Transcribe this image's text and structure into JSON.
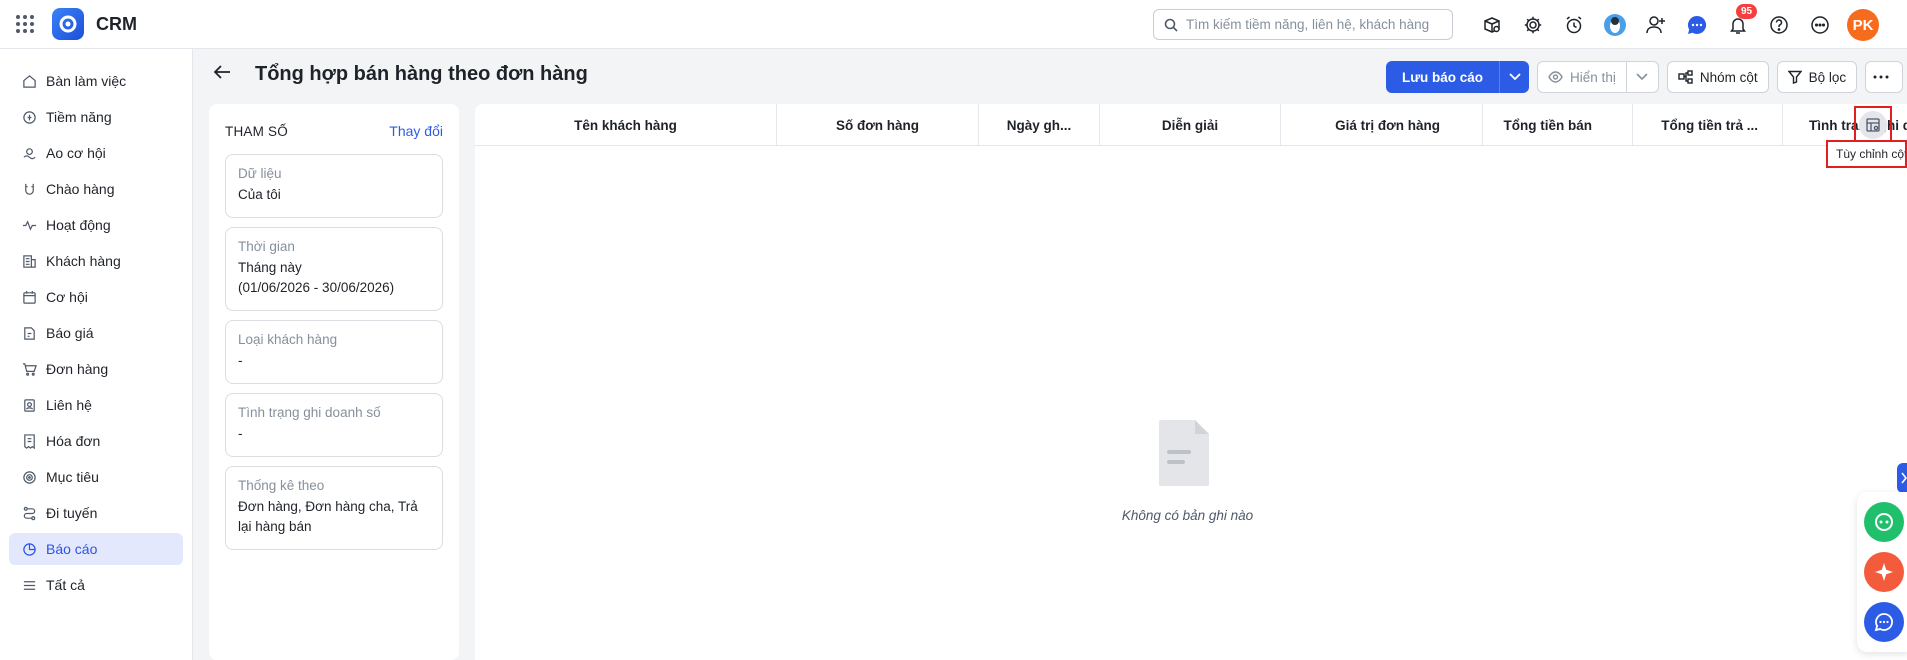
{
  "app": {
    "name": "CRM"
  },
  "search": {
    "placeholder": "Tìm kiếm tiềm năng, liên hệ, khách hàng"
  },
  "topbar": {
    "notification_count": "95",
    "avatar_initials": "PK"
  },
  "sidebar": {
    "items": [
      {
        "label": "Bàn làm việc",
        "icon": "home-icon"
      },
      {
        "label": "Tiềm năng",
        "icon": "target-coin-icon"
      },
      {
        "label": "Ao cơ hội",
        "icon": "pond-icon"
      },
      {
        "label": "Chào hàng",
        "icon": "magnet-icon"
      },
      {
        "label": "Hoạt động",
        "icon": "activity-icon"
      },
      {
        "label": "Khách hàng",
        "icon": "building-icon"
      },
      {
        "label": "Cơ hội",
        "icon": "calendar-icon"
      },
      {
        "label": "Báo giá",
        "icon": "quote-doc-icon"
      },
      {
        "label": "Đơn hàng",
        "icon": "cart-icon"
      },
      {
        "label": "Liên hệ",
        "icon": "contact-icon"
      },
      {
        "label": "Hóa đơn",
        "icon": "invoice-icon"
      },
      {
        "label": "Mục tiêu",
        "icon": "goal-icon"
      },
      {
        "label": "Đi tuyến",
        "icon": "route-icon"
      },
      {
        "label": "Báo cáo",
        "icon": "report-pie-icon",
        "active": true
      },
      {
        "label": "Tất cả",
        "icon": "menu-lines-icon"
      }
    ]
  },
  "page": {
    "title": "Tổng hợp bán hàng theo đơn hàng"
  },
  "toolbar": {
    "save_label": "Lưu báo cáo",
    "display_label": "Hiển thị",
    "group_label": "Nhóm cột",
    "filter_label": "Bộ lọc"
  },
  "params": {
    "title": "THAM SỐ",
    "change_label": "Thay đổi",
    "cards": [
      {
        "label": "Dữ liệu",
        "value": "Của tôi"
      },
      {
        "label": "Thời gian",
        "value": "Tháng này\n(01/06/2026 - 30/06/2026)"
      },
      {
        "label": "Loại khách hàng",
        "value": "-"
      },
      {
        "label": "Tình trạng ghi doanh số",
        "value": "-"
      },
      {
        "label": "Thống kê theo",
        "value": "Đơn hàng, Đơn hàng cha, Trả lại hàng bán"
      }
    ]
  },
  "table": {
    "columns": [
      "Tên khách hàng",
      "Số đơn hàng",
      "Ngày gh...",
      "Diễn giải",
      "Giá trị đơn hàng",
      "Tổng tiền bán",
      "Tổng tiền trả ...",
      "Tình trạng ghi d"
    ],
    "column_config_tooltip": "Tùy chỉnh cột",
    "empty_text": "Không có bản ghi nào"
  }
}
